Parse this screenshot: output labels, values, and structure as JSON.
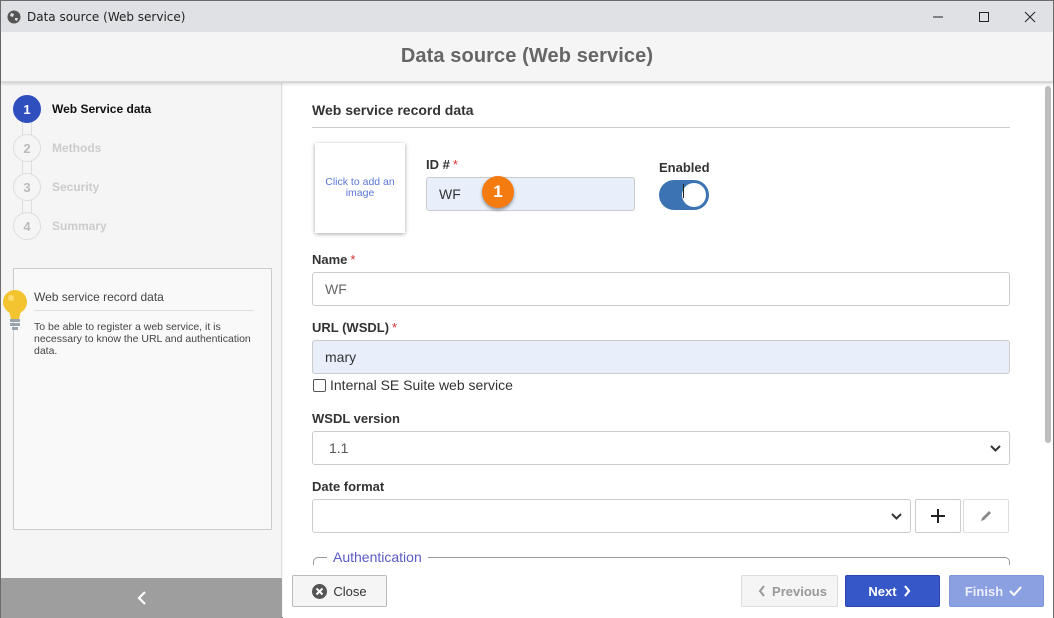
{
  "window": {
    "title": "Data source (Web service)",
    "controls": [
      "minimize",
      "maximize",
      "close"
    ]
  },
  "header": {
    "title": "Data source (Web service)"
  },
  "sidebar": {
    "steps": [
      {
        "number": "1",
        "label": "Web Service data",
        "active": true
      },
      {
        "number": "2",
        "label": "Methods",
        "active": false
      },
      {
        "number": "3",
        "label": "Security",
        "active": false
      },
      {
        "number": "4",
        "label": "Summary",
        "active": false
      }
    ],
    "help": {
      "icon": "lightbulb-icon",
      "title": "Web service record data",
      "text": "To be able to register a web service, it is necessary to know the URL and authentication data."
    },
    "collapse_icon": "chevron-left-icon"
  },
  "form": {
    "section_title": "Web service record data",
    "image_placeholder": "Click to add an image",
    "id": {
      "label": "ID #",
      "required_mark": "*",
      "value": "WF"
    },
    "enabled": {
      "label": "Enabled",
      "value": true
    },
    "callout_badge": "1",
    "name": {
      "label": "Name",
      "required_mark": "*",
      "value": "WF"
    },
    "url": {
      "label": "URL (WSDL)",
      "required_mark": "*",
      "value": "mary"
    },
    "internal_checkbox": {
      "label": "Internal SE Suite web service",
      "checked": false
    },
    "wsdl_version": {
      "label": "WSDL version",
      "value": "1.1"
    },
    "date_format": {
      "label": "Date format",
      "value": ""
    },
    "authentication": {
      "legend": "Authentication"
    }
  },
  "footer": {
    "close_label": "Close",
    "previous_label": "Previous",
    "next_label": "Next",
    "finish_label": "Finish"
  },
  "colors": {
    "accent": "#3557c7",
    "active_step": "#2f4fbe",
    "toggle_on": "#3c74b3",
    "badge": "#f47b0f",
    "required": "#e03030",
    "filled_input": "#e8effb"
  }
}
